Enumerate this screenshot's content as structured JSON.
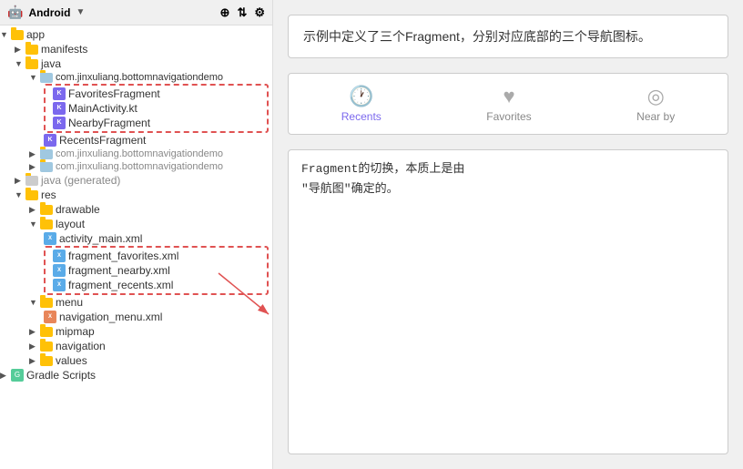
{
  "header": {
    "android_label": "Android",
    "dropdown_icon": "▼",
    "icon1": "⊕",
    "icon2": "⇅",
    "icon3": "⚙"
  },
  "tree": {
    "items": [
      {
        "id": "app",
        "label": "app",
        "type": "folder",
        "level": 0,
        "expanded": true
      },
      {
        "id": "manifests",
        "label": "manifests",
        "type": "folder",
        "level": 1,
        "expanded": false
      },
      {
        "id": "java",
        "label": "java",
        "type": "folder",
        "level": 1,
        "expanded": true
      },
      {
        "id": "com.jinxuliang.bottomnavigationdemo",
        "label": "com.jinxuliang.bottomnavigationdemo",
        "type": "package",
        "level": 2,
        "expanded": true
      },
      {
        "id": "FavoritesFragment",
        "label": "FavoritesFragment",
        "type": "kt",
        "level": 3,
        "dashed": true
      },
      {
        "id": "MainActivity.kt",
        "label": "MainActivity.kt",
        "type": "kt",
        "level": 3,
        "dashed": true
      },
      {
        "id": "NearbyFragment",
        "label": "NearbyFragment",
        "type": "kt",
        "level": 3,
        "dashed": true
      },
      {
        "id": "RecentsFragment",
        "label": "RecentsFragment",
        "type": "kt",
        "level": 3,
        "dashed": false
      },
      {
        "id": "com.jinxuliang.bottomnavigationdemo2",
        "label": "com.jinxuliang.bottomnavigationdemo",
        "type": "package-gray",
        "level": 2
      },
      {
        "id": "com.jinxuliang.bottomnavigationdemo3",
        "label": "com.jinxuliang.bottomnavigationdemo",
        "type": "package-gray",
        "level": 2
      },
      {
        "id": "java-generated",
        "label": "java (generated)",
        "type": "folder-gray",
        "level": 1
      },
      {
        "id": "res",
        "label": "res",
        "type": "folder",
        "level": 1,
        "expanded": true
      },
      {
        "id": "drawable",
        "label": "drawable",
        "type": "folder",
        "level": 2,
        "expanded": false
      },
      {
        "id": "layout",
        "label": "layout",
        "type": "folder",
        "level": 2,
        "expanded": true
      },
      {
        "id": "activity_main.xml",
        "label": "activity_main.xml",
        "type": "xml-layout",
        "level": 3
      },
      {
        "id": "fragment_favorites.xml",
        "label": "fragment_favorites.xml",
        "type": "xml-layout",
        "level": 3,
        "dashed": true
      },
      {
        "id": "fragment_nearby.xml",
        "label": "fragment_nearby.xml",
        "type": "xml-layout",
        "level": 3,
        "dashed": true
      },
      {
        "id": "fragment_recents.xml",
        "label": "fragment_recents.xml",
        "type": "xml-layout",
        "level": 3,
        "dashed": true
      },
      {
        "id": "menu",
        "label": "menu",
        "type": "folder",
        "level": 2,
        "expanded": true
      },
      {
        "id": "navigation_menu.xml",
        "label": "navigation_menu.xml",
        "type": "xml",
        "level": 3
      },
      {
        "id": "mipmap",
        "label": "mipmap",
        "type": "folder",
        "level": 2,
        "expanded": false
      },
      {
        "id": "navigation",
        "label": "navigation",
        "type": "folder",
        "level": 2,
        "expanded": false
      },
      {
        "id": "values",
        "label": "values",
        "type": "folder",
        "level": 2,
        "expanded": false
      },
      {
        "id": "gradle-scripts",
        "label": "Gradle Scripts",
        "type": "gradle",
        "level": 0
      }
    ]
  },
  "annotation1": {
    "text": "示例中定义了三个Fragment，分别对应底部的三个导航图标。"
  },
  "bottom_nav": {
    "items": [
      {
        "label": "Recents",
        "icon": "🕐",
        "active": true
      },
      {
        "label": "Favorites",
        "icon": "♥",
        "active": false
      },
      {
        "label": "Near by",
        "icon": "◎",
        "active": false
      }
    ]
  },
  "annotation2": {
    "text": "Fragment的切换，本质上是由\n\"导航图\"确定的。"
  }
}
